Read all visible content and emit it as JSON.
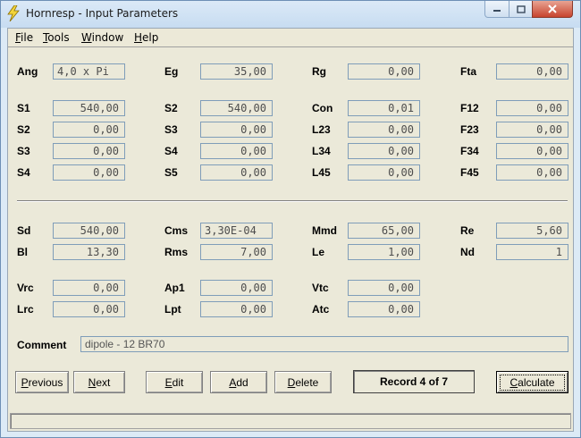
{
  "window": {
    "title": "Hornresp - Input Parameters"
  },
  "menu": [
    {
      "label": "File",
      "accel": "F",
      "rest": "ile"
    },
    {
      "label": "Tools",
      "accel": "T",
      "rest": "ools"
    },
    {
      "label": "Window",
      "accel": "W",
      "rest": "indow"
    },
    {
      "label": "Help",
      "accel": "H",
      "rest": "elp"
    }
  ],
  "params": {
    "ang": {
      "label": "Ang",
      "value": "4,0 x Pi"
    },
    "eg": {
      "label": "Eg",
      "value": "35,00"
    },
    "rg": {
      "label": "Rg",
      "value": "0,00"
    },
    "fta": {
      "label": "Fta",
      "value": "0,00"
    },
    "s1": {
      "label": "S1",
      "value": "540,00"
    },
    "s2a": {
      "label": "S2",
      "value": "540,00"
    },
    "con": {
      "label": "Con",
      "value": "0,01"
    },
    "f12": {
      "label": "F12",
      "value": "0,00"
    },
    "s2b": {
      "label": "S2",
      "value": "0,00"
    },
    "s3a": {
      "label": "S3",
      "value": "0,00"
    },
    "l23": {
      "label": "L23",
      "value": "0,00"
    },
    "f23": {
      "label": "F23",
      "value": "0,00"
    },
    "s3b": {
      "label": "S3",
      "value": "0,00"
    },
    "s4a": {
      "label": "S4",
      "value": "0,00"
    },
    "l34": {
      "label": "L34",
      "value": "0,00"
    },
    "f34": {
      "label": "F34",
      "value": "0,00"
    },
    "s4b": {
      "label": "S4",
      "value": "0,00"
    },
    "s5": {
      "label": "S5",
      "value": "0,00"
    },
    "l45": {
      "label": "L45",
      "value": "0,00"
    },
    "f45": {
      "label": "F45",
      "value": "0,00"
    },
    "sd": {
      "label": "Sd",
      "value": "540,00"
    },
    "cms": {
      "label": "Cms",
      "value": "3,30E-04"
    },
    "mmd": {
      "label": "Mmd",
      "value": "65,00"
    },
    "re": {
      "label": "Re",
      "value": "5,60"
    },
    "bl": {
      "label": "Bl",
      "value": "13,30"
    },
    "rms": {
      "label": "Rms",
      "value": "7,00"
    },
    "le": {
      "label": "Le",
      "value": "1,00"
    },
    "nd": {
      "label": "Nd",
      "value": "1"
    },
    "vrc": {
      "label": "Vrc",
      "value": "0,00"
    },
    "ap1": {
      "label": "Ap1",
      "value": "0,00"
    },
    "vtc": {
      "label": "Vtc",
      "value": "0,00"
    },
    "lrc": {
      "label": "Lrc",
      "value": "0,00"
    },
    "lpt": {
      "label": "Lpt",
      "value": "0,00"
    },
    "atc": {
      "label": "Atc",
      "value": "0,00"
    }
  },
  "comment": {
    "label": "Comment",
    "value": "dipole - 12 BR70"
  },
  "buttons": {
    "previous": {
      "label": "Previous",
      "accel": "P",
      "rest": "revious"
    },
    "next": {
      "label": "Next",
      "accel": "N",
      "rest": "ext"
    },
    "edit": {
      "label": "Edit",
      "accel": "E",
      "rest": "dit"
    },
    "add": {
      "label": "Add",
      "accel": "A",
      "rest": "dd"
    },
    "delete": {
      "label": "Delete",
      "accel": "D",
      "rest": "elete"
    },
    "calculate": {
      "label": "Calculate",
      "accel": "C",
      "rest": "alculate"
    }
  },
  "record": "Record 4 of 7",
  "icons": {
    "app": "lightning-bolt-icon",
    "minimize": "minimize-icon",
    "maximize": "maximize-icon",
    "close": "close-icon"
  },
  "colors": {
    "client_bg": "#ece9d8",
    "field_border": "#7f9db9",
    "close_button": "#c8442e"
  }
}
